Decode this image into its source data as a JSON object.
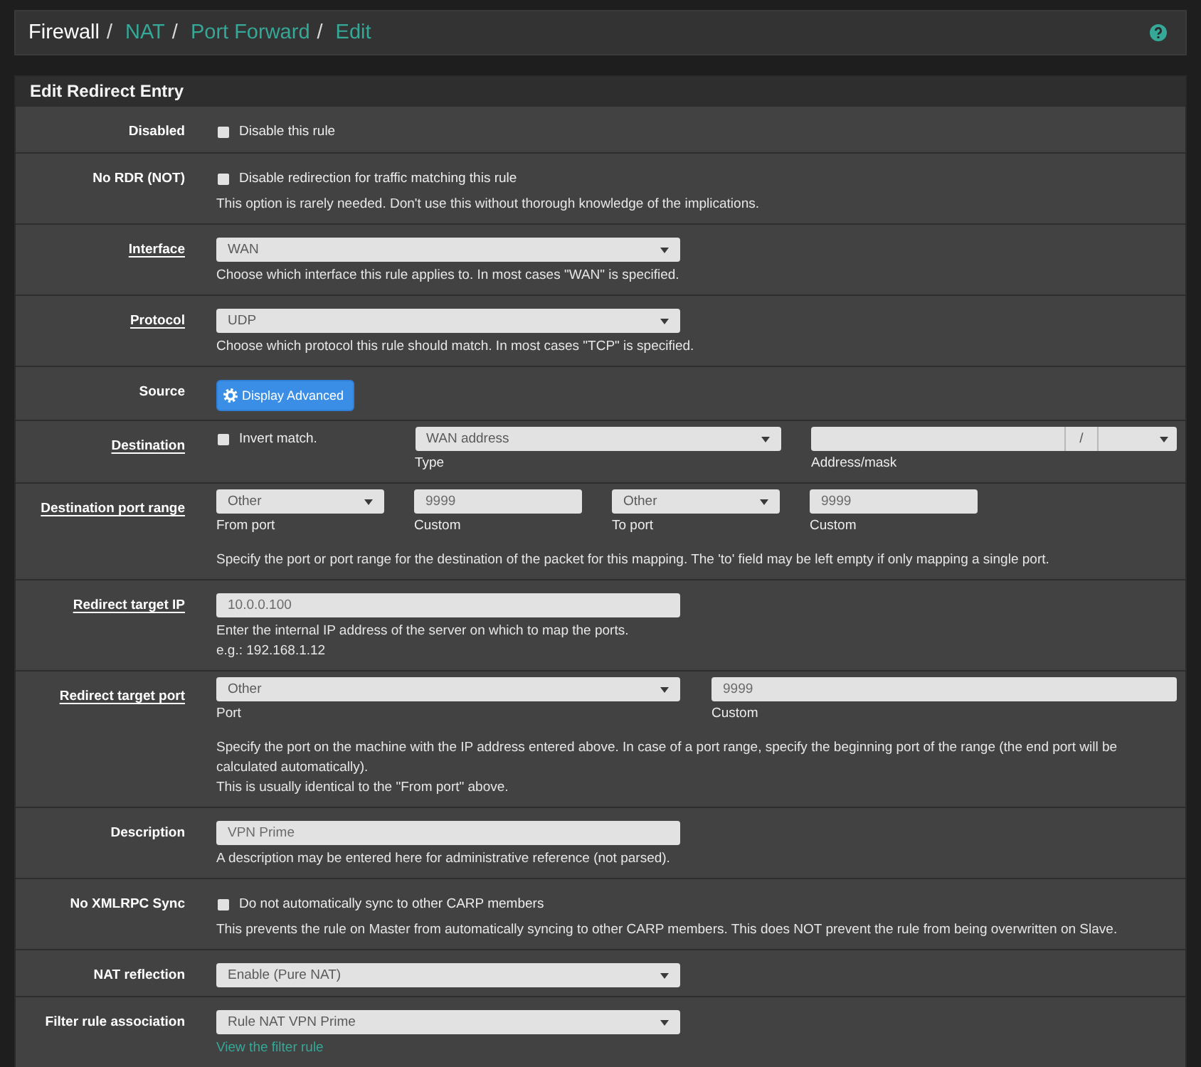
{
  "header": {
    "breadcrumb": [
      {
        "label": "Firewall",
        "link": false,
        "separator": "/"
      },
      {
        "label": "NAT",
        "link": true,
        "separator": "/"
      },
      {
        "label": "Port Forward",
        "link": true,
        "separator": "/"
      },
      {
        "label": "Edit",
        "link": true
      }
    ]
  },
  "panel": {
    "title": "Edit Redirect Entry",
    "rows": [
      {
        "label": "Disabled",
        "label_link": false,
        "kind": "single",
        "controls": [
          {
            "kind": "checkbox",
            "label": "Disable this rule",
            "checked": false
          }
        ]
      },
      {
        "label": "No RDR (NOT)",
        "label_link": false,
        "kind": "single",
        "controls": [
          {
            "kind": "checkbox",
            "label": "Disable redirection for traffic matching this rule",
            "checked": false
          }
        ],
        "help": [
          "This option is rarely needed. Don't use this without thorough knowledge of the implications."
        ]
      },
      {
        "label": "Interface",
        "label_link": true,
        "kind": "single",
        "controls": [
          {
            "kind": "select",
            "value": "WAN"
          }
        ],
        "help": [
          "Choose which interface this rule applies to. In most cases \"WAN\" is specified."
        ]
      },
      {
        "label": "Protocol",
        "label_link": true,
        "kind": "single",
        "controls": [
          {
            "kind": "select",
            "value": "UDP"
          }
        ],
        "help": [
          "Choose which protocol this rule should match. In most cases \"TCP\" is specified."
        ]
      },
      {
        "label": "Source",
        "label_link": false,
        "kind": "single",
        "controls": [
          {
            "kind": "button",
            "label": "Display Advanced"
          }
        ]
      },
      {
        "label": "Destination",
        "label_link": true,
        "kind": "destination",
        "controls": [
          {
            "kind": "checkbox",
            "label": "Invert match.",
            "checked": false
          },
          {
            "kind": "select",
            "value": "WAN address",
            "caption": "Type"
          },
          {
            "kind": "address",
            "separator": "/",
            "caption": "Address/mask"
          }
        ]
      },
      {
        "label": "Destination port range",
        "label_link": true,
        "kind": "port_range",
        "controls": [
          {
            "kind": "select",
            "value": "Other",
            "caption": "From port"
          },
          {
            "kind": "input",
            "value": "9999",
            "caption": "Custom"
          },
          {
            "kind": "select",
            "value": "Other",
            "caption": "To port"
          },
          {
            "kind": "input",
            "value": "9999",
            "caption": "Custom"
          }
        ],
        "help": [
          "Specify the port or port range for the destination of the packet for this mapping. The 'to' field may be left empty if only mapping a single port."
        ]
      },
      {
        "label": "Redirect target IP",
        "label_link": true,
        "kind": "single",
        "controls": [
          {
            "kind": "input",
            "value": "10.0.0.100"
          }
        ],
        "help": [
          "Enter the internal IP address of the server on which to map the ports.",
          "e.g.: 192.168.1.12"
        ]
      },
      {
        "label": "Redirect target port",
        "label_link": true,
        "kind": "pair",
        "controls": [
          {
            "kind": "select",
            "value": "Other",
            "caption": "Port"
          },
          {
            "kind": "input",
            "value": "9999",
            "caption": "Custom"
          }
        ],
        "help": [
          "Specify the port on the machine with the IP address entered above. In case of a port range, specify the beginning port of the range (the end port will be calculated automatically).",
          "This is usually identical to the \"From port\" above."
        ]
      },
      {
        "label": "Description",
        "label_link": false,
        "kind": "single",
        "controls": [
          {
            "kind": "input",
            "value": "VPN Prime"
          }
        ],
        "help": [
          "A description may be entered here for administrative reference (not parsed)."
        ]
      },
      {
        "label": "No XMLRPC Sync",
        "label_link": false,
        "kind": "single",
        "controls": [
          {
            "kind": "checkbox",
            "label": "Do not automatically sync to other CARP members",
            "checked": false
          }
        ],
        "help": [
          "This prevents the rule on Master from automatically syncing to other CARP members. This does NOT prevent the rule from being overwritten on Slave."
        ]
      },
      {
        "label": "NAT reflection",
        "label_link": false,
        "kind": "single",
        "controls": [
          {
            "kind": "select",
            "value": "Enable (Pure NAT)"
          }
        ]
      },
      {
        "label": "Filter rule association",
        "label_link": false,
        "kind": "single",
        "controls": [
          {
            "kind": "select",
            "value": "Rule NAT VPN Prime"
          }
        ],
        "links": [
          {
            "label": "View the filter rule"
          }
        ]
      }
    ]
  }
}
